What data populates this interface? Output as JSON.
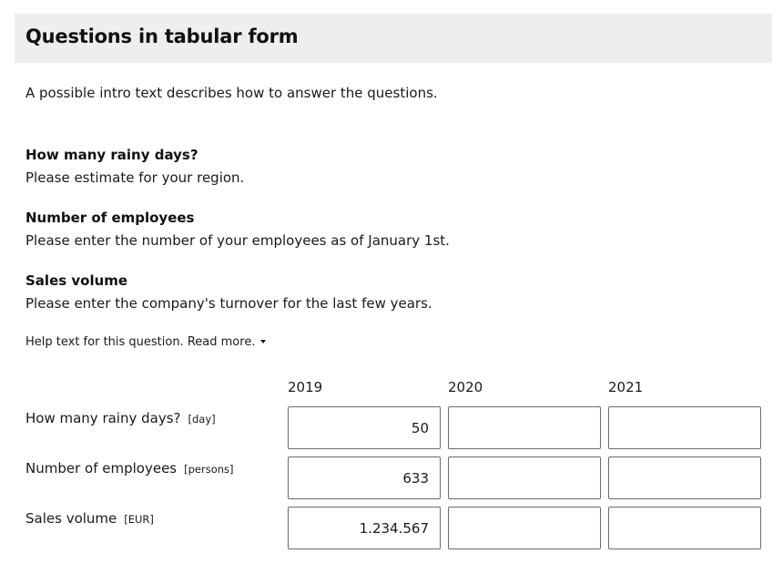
{
  "header": {
    "title": "Questions in tabular form"
  },
  "intro": {
    "text": "A possible intro text describes how to answer the questions."
  },
  "questions": [
    {
      "title": "How many rainy days?",
      "description": "Please estimate for your region."
    },
    {
      "title": "Number of employees",
      "description": "Please enter the number of your employees as of January 1st."
    },
    {
      "title": "Sales volume",
      "description": "Please enter the company's turnover for the last few years."
    }
  ],
  "help": {
    "label": "Help text for this question. Read more.",
    "icon": "caret-down-icon"
  },
  "table": {
    "columns": [
      "2019",
      "2020",
      "2021"
    ],
    "rows": [
      {
        "label": "How many rainy days?",
        "unit": "[day]",
        "values": [
          "50",
          "",
          ""
        ]
      },
      {
        "label": "Number of employees",
        "unit": "[persons]",
        "values": [
          "633",
          "",
          ""
        ]
      },
      {
        "label": "Sales volume",
        "unit": "[EUR]",
        "values": [
          "1.234.567",
          "",
          ""
        ]
      }
    ]
  }
}
